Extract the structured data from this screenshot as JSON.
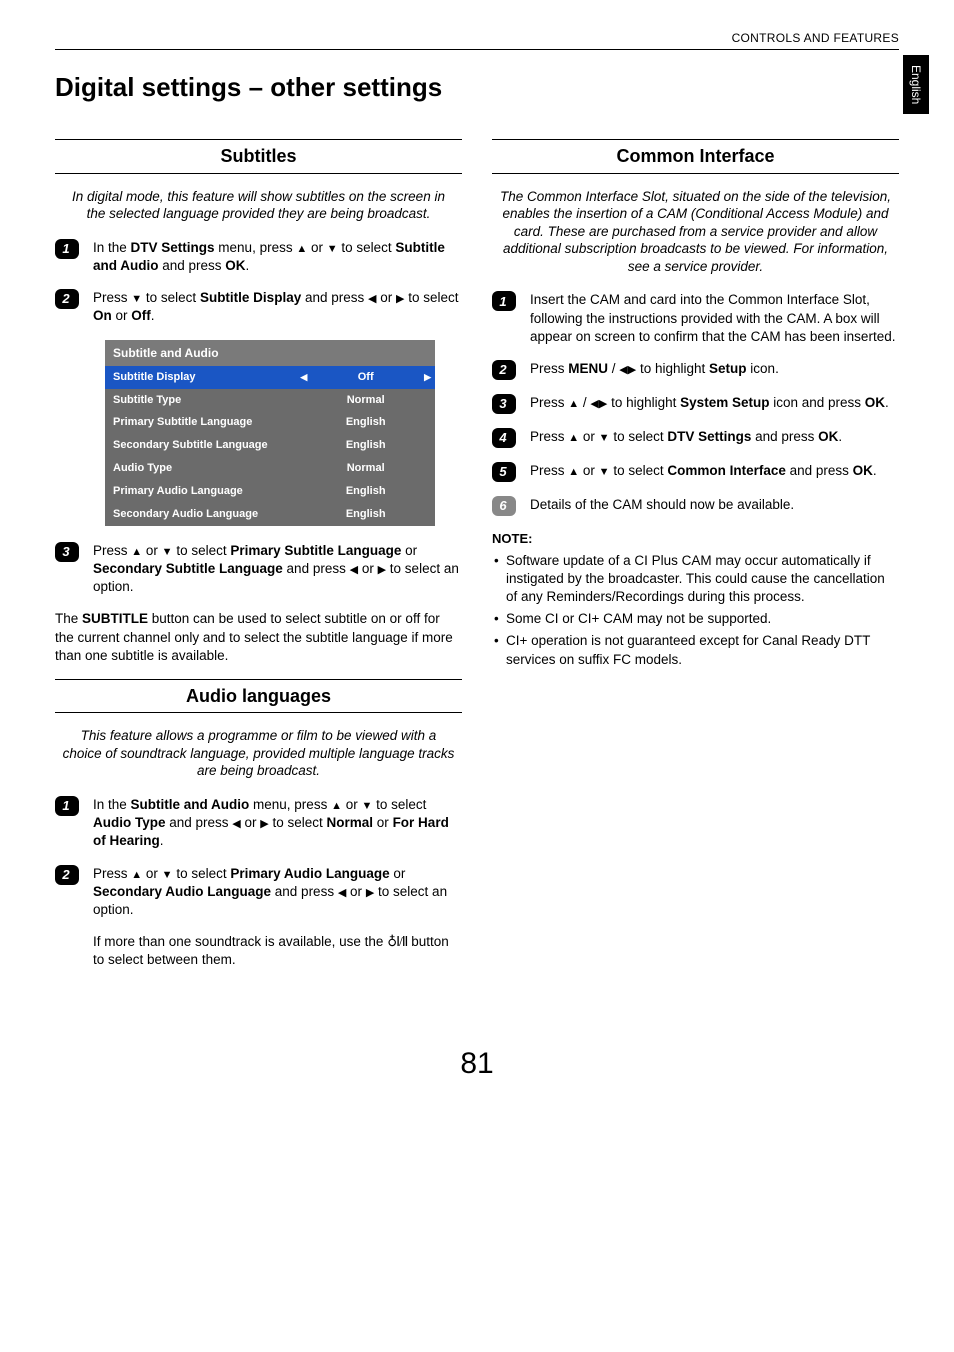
{
  "header": {
    "running_head": "CONTROLS AND FEATURES"
  },
  "side_tab": "English",
  "page_title": "Digital settings – other settings",
  "page_number": "81",
  "left": {
    "subtitles": {
      "heading": "Subtitles",
      "intro": "In digital mode, this feature will show subtitles on the screen in the selected language provided they are being broadcast.",
      "step1_a": "In the ",
      "step1_b": "DTV Settings",
      "step1_c": " menu, press ",
      "step1_d": " or ",
      "step1_e": " to select ",
      "step1_f": "Subtitle and Audio",
      "step1_g": " and press ",
      "step1_h": "OK",
      "step1_i": ".",
      "step2_a": "Press ",
      "step2_b": " to select ",
      "step2_c": "Subtitle Display",
      "step2_d": " and press ",
      "step2_e": " or ",
      "step2_f": " to select ",
      "step2_g": "On",
      "step2_h": " or ",
      "step2_i": "Off",
      "step2_j": ".",
      "table_header": "Subtitle and Audio",
      "rows": [
        {
          "label": "Subtitle Display",
          "value": "Off",
          "highlight": true
        },
        {
          "label": "Subtitle Type",
          "value": "Normal"
        },
        {
          "label": "Primary Subtitle Language",
          "value": "English"
        },
        {
          "label": "Secondary Subtitle Language",
          "value": "English"
        },
        {
          "label": "Audio Type",
          "value": "Normal"
        },
        {
          "label": "Primary Audio Language",
          "value": "English"
        },
        {
          "label": "Secondary Audio Language",
          "value": "English"
        }
      ],
      "step3_a": "Press ",
      "step3_b": " or ",
      "step3_c": " to select ",
      "step3_d": "Primary Subtitle Language",
      "step3_e": " or ",
      "step3_f": "Secondary Subtitle Language",
      "step3_g": " and press ",
      "step3_h": " or ",
      "step3_i": " to select an option.",
      "after_a": "The ",
      "after_b": "SUBTITLE",
      "after_c": " button can be used to select subtitle on or off for the current channel only and to select the subtitle language if more than one subtitle is available."
    },
    "audio": {
      "heading": "Audio languages",
      "intro": "This feature allows a programme or film to be viewed with a choice of soundtrack language, provided multiple language tracks are being broadcast.",
      "step1_a": "In the ",
      "step1_b": "Subtitle and Audio",
      "step1_c": " menu, press ",
      "step1_d": " or ",
      "step1_e": " to select ",
      "step1_f": "Audio Type",
      "step1_g": " and press ",
      "step1_h": " or ",
      "step1_i": " to select ",
      "step1_j": "Normal",
      "step1_k": " or ",
      "step1_l": "For Hard of Hearing",
      "step1_m": ".",
      "step2_a": "Press ",
      "step2_b": " or ",
      "step2_c": " to select ",
      "step2_d": "Primary Audio Language",
      "step2_e": " or ",
      "step2_f": "Secondary Audio Language",
      "step2_g": " and press ",
      "step2_h": " or ",
      "step2_i": " to select an option.",
      "after_a": "If more than one soundtrack is available, use the ",
      "after_b": " button to select between them."
    }
  },
  "right": {
    "ci": {
      "heading": "Common Interface",
      "intro": "The Common Interface Slot, situated on the side of the television, enables the insertion of a CAM (Conditional Access Module) and card. These are purchased from a service provider and allow additional subscription broadcasts to be viewed. For information, see a service provider.",
      "step1": "Insert the CAM and card into the Common Interface Slot, following the instructions provided with the CAM. A box will appear on screen to confirm that the CAM has been inserted.",
      "step2_a": "Press ",
      "step2_b": "MENU",
      "step2_c": " / ",
      "step2_d": " to highlight ",
      "step2_e": "Setup",
      "step2_f": " icon.",
      "step3_a": "Press ",
      "step3_b": " / ",
      "step3_c": " to highlight ",
      "step3_d": "System Setup",
      "step3_e": " icon and press ",
      "step3_f": "OK",
      "step3_g": ".",
      "step4_a": "Press ",
      "step4_b": " or ",
      "step4_c": " to select ",
      "step4_d": "DTV Settings",
      "step4_e": " and press ",
      "step4_f": "OK",
      "step4_g": ".",
      "step5_a": "Press ",
      "step5_b": " or ",
      "step5_c": " to select ",
      "step5_d": "Common Interface",
      "step5_e": " and press ",
      "step5_f": "OK",
      "step5_g": ".",
      "step6": "Details of the CAM should now be available.",
      "note_head": "NOTE:",
      "notes": [
        "Software update of a CI Plus CAM may occur automatically if instigated by the broadcaster. This could cause the cancellation of any Reminders/Recordings during this process.",
        "Some CI or CI+ CAM may not be supported.",
        "CI+ operation is not guaranteed except for Canal Ready DTT services on suffix FC models."
      ]
    }
  }
}
